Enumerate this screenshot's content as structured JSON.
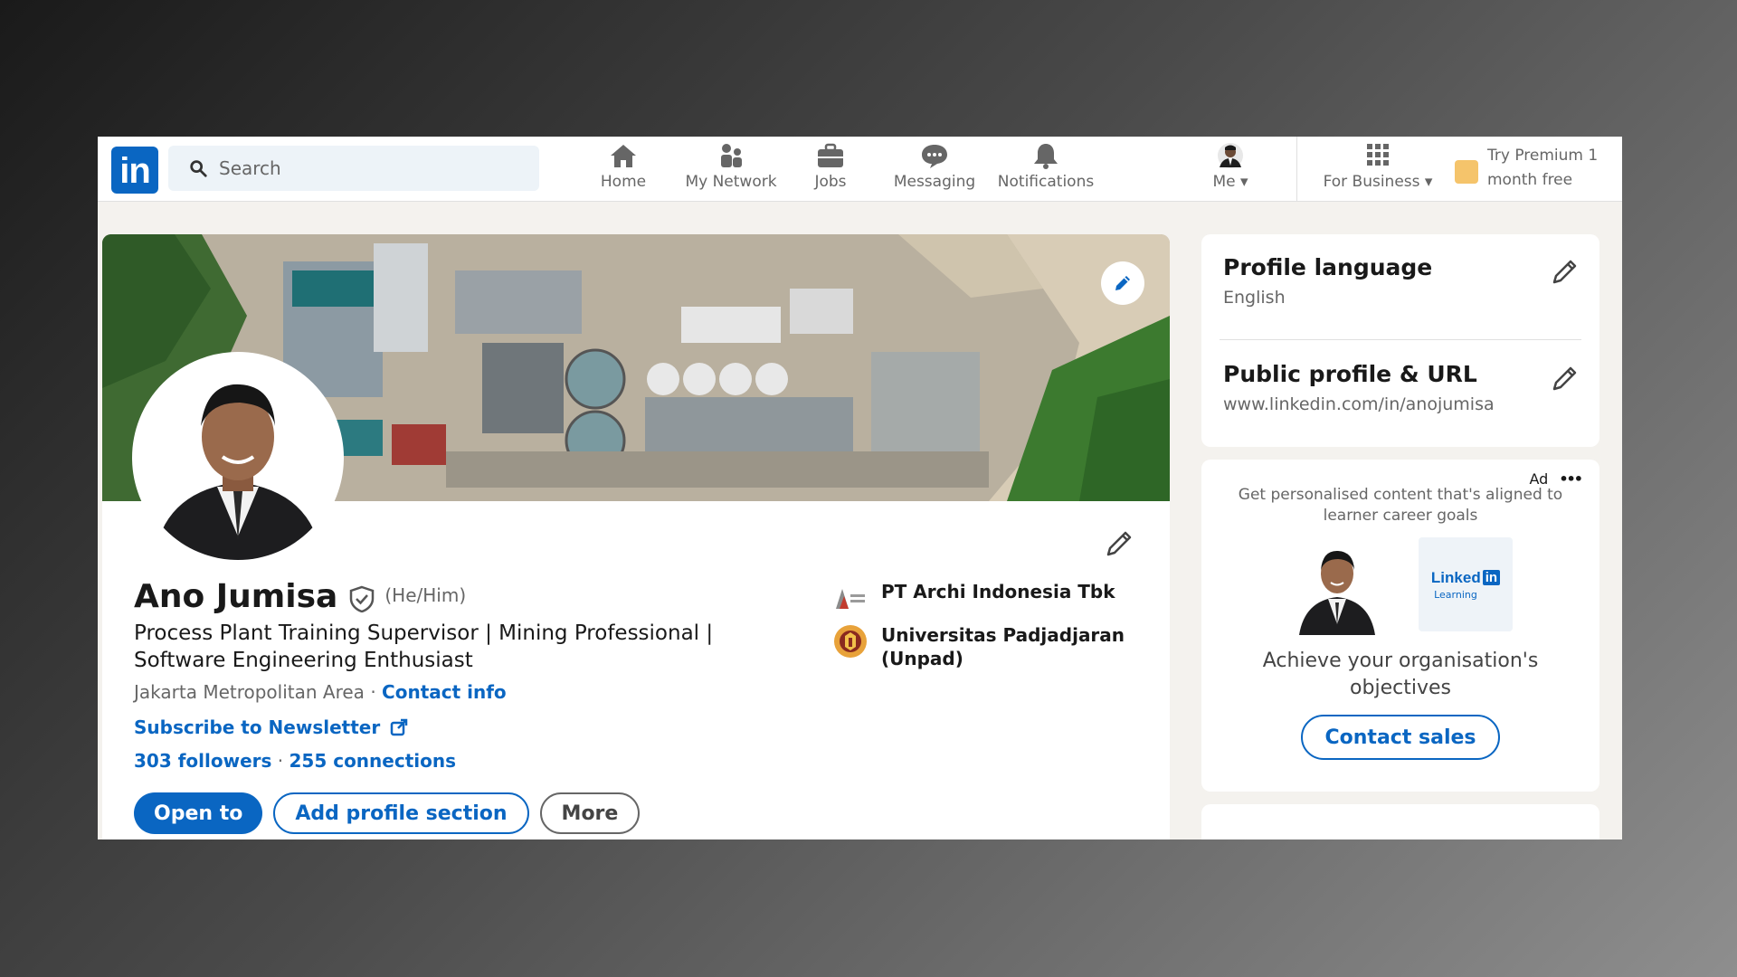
{
  "nav": {
    "logo": "in",
    "search_placeholder": "Search",
    "items": [
      {
        "label": "Home",
        "icon": "home-icon"
      },
      {
        "label": "My Network",
        "icon": "network-icon"
      },
      {
        "label": "Jobs",
        "icon": "briefcase-icon"
      },
      {
        "label": "Messaging",
        "icon": "messaging-icon"
      },
      {
        "label": "Notifications",
        "icon": "bell-icon"
      },
      {
        "label": "Me",
        "icon": "avatar-icon"
      },
      {
        "label": "For Business",
        "icon": "grid-icon"
      }
    ],
    "premium_line1": "Try Premium 1",
    "premium_line2": "month free"
  },
  "profile": {
    "name": "Ano Jumisa",
    "pronouns": "(He/Him)",
    "headline_line1": "Process Plant Training Supervisor | Mining Professional |",
    "headline_line2": "Software Engineering Enthusiast",
    "location": "Jakarta Metropolitan Area",
    "separator": "·",
    "contact_info": "Contact info",
    "newsletter": "Subscribe to Newsletter",
    "followers": "303 followers",
    "connections": "255 connections",
    "buttons": {
      "open_to": "Open to",
      "add_section": "Add profile section",
      "more": "More"
    },
    "company": "PT Archi Indonesia Tbk",
    "university_line1": "Universitas Padjadjaran",
    "university_line2": "(Unpad)"
  },
  "sidebar": {
    "profile_language": {
      "title": "Profile language",
      "value": "English"
    },
    "public_profile": {
      "title": "Public profile & URL",
      "value": "www.linkedin.com/in/anojumisa"
    },
    "ad": {
      "label": "Ad",
      "more": "•••",
      "description_line1": "Get personalised content that's aligned to",
      "description_line2": "learner career goals",
      "brand": "Linked",
      "brand_in": "in",
      "brand_sub": "Learning",
      "headline_line1": "Achieve your organisation's",
      "headline_line2": "objectives",
      "button": "Contact sales"
    }
  },
  "colors": {
    "brand": "#0a66c2",
    "background": "#f4f2ee",
    "premium": "#f5c46b"
  }
}
